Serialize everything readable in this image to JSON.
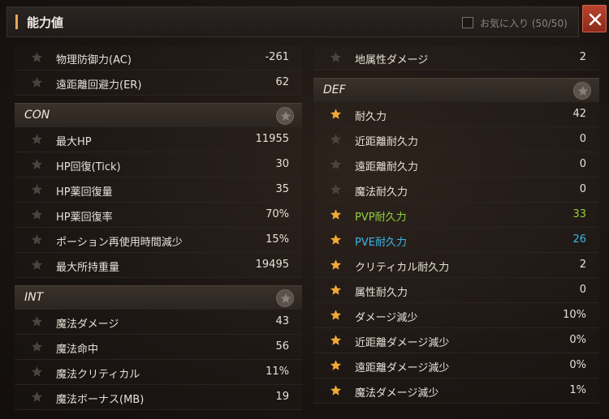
{
  "window": {
    "title": "能力値",
    "favorites_label": "お気に入り (50/50)",
    "close_icon": "close-icon"
  },
  "colors": {
    "accent": "#e9a65c",
    "star_active": "#f2a935",
    "star_inactive": "#4a443f",
    "green": "#8fd33e",
    "blue": "#39b6e8",
    "close_bg": "#a9381f"
  },
  "left": {
    "top_rows": [
      {
        "label": "物理防御力(AC)",
        "value": "-261",
        "fav": false
      },
      {
        "label": "遠距離回避力(ER)",
        "value": "62",
        "fav": false
      }
    ],
    "con": {
      "name": "CON",
      "rows": [
        {
          "label": "最大HP",
          "value": "11955",
          "fav": false
        },
        {
          "label": "HP回復(Tick)",
          "value": "30",
          "fav": false
        },
        {
          "label": "HP薬回復量",
          "value": "35",
          "fav": false
        },
        {
          "label": "HP薬回復率",
          "value": "70%",
          "fav": false
        },
        {
          "label": "ポーション再使用時間減少",
          "value": "15%",
          "fav": false
        },
        {
          "label": "最大所持重量",
          "value": "19495",
          "fav": false
        }
      ]
    },
    "int": {
      "name": "INT",
      "rows": [
        {
          "label": "魔法ダメージ",
          "value": "43",
          "fav": false
        },
        {
          "label": "魔法命中",
          "value": "56",
          "fav": false
        },
        {
          "label": "魔法クリティカル",
          "value": "11%",
          "fav": false
        },
        {
          "label": "魔法ボーナス(MB)",
          "value": "19",
          "fav": false
        }
      ]
    }
  },
  "right": {
    "top_rows": [
      {
        "label": "地属性ダメージ",
        "value": "2",
        "fav": false
      }
    ],
    "def": {
      "name": "DEF",
      "rows": [
        {
          "label": "耐久力",
          "value": "42",
          "fav": true
        },
        {
          "label": "近距離耐久力",
          "value": "0",
          "fav": false
        },
        {
          "label": "遠距離耐久力",
          "value": "0",
          "fav": false
        },
        {
          "label": "魔法耐久力",
          "value": "0",
          "fav": false
        },
        {
          "label": "PVP耐久力",
          "value": "33",
          "fav": true
        },
        {
          "label": "PVE耐久力",
          "value": "26",
          "fav": true
        },
        {
          "label": "クリティカル耐久力",
          "value": "2",
          "fav": true
        },
        {
          "label": "属性耐久力",
          "value": "0",
          "fav": true
        },
        {
          "label": "ダメージ減少",
          "value": "10%",
          "fav": true
        },
        {
          "label": "近距離ダメージ減少",
          "value": "0%",
          "fav": true
        },
        {
          "label": "遠距離ダメージ減少",
          "value": "0%",
          "fav": true
        },
        {
          "label": "魔法ダメージ減少",
          "value": "1%",
          "fav": true
        }
      ]
    }
  }
}
